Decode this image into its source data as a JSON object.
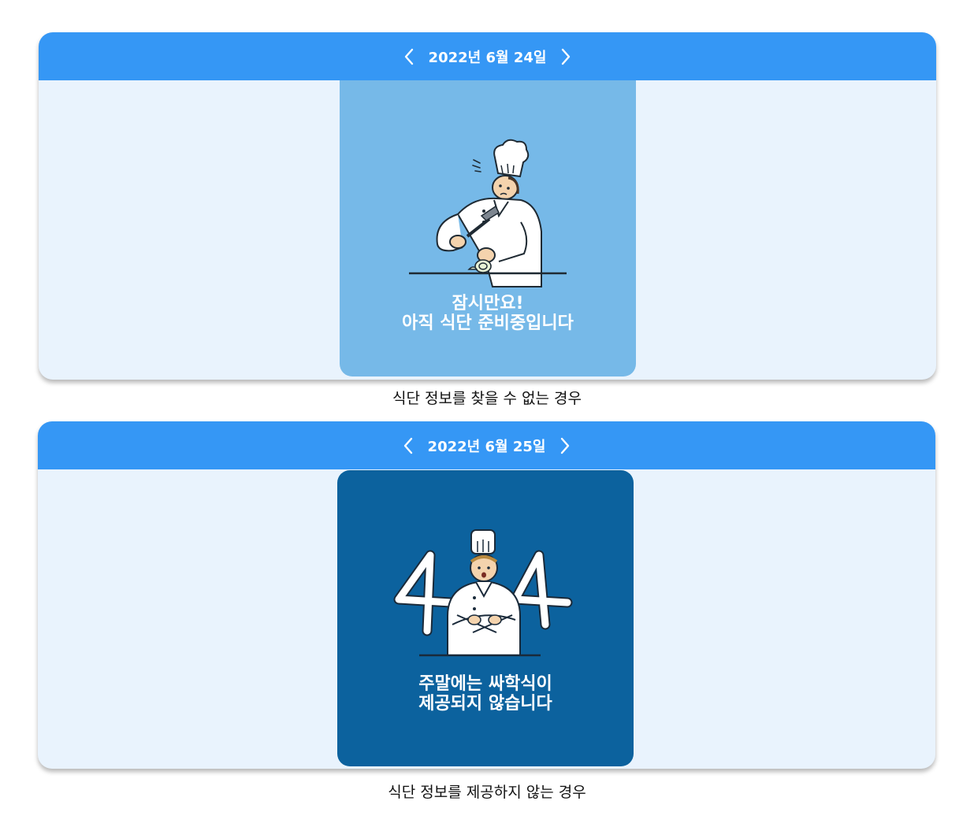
{
  "cards": [
    {
      "date": "2022년 6월 24일",
      "message": [
        "잠시만요!",
        "아직 식단 준비중입니다"
      ],
      "caption": "식단 정보를 찾을 수 없는 경우",
      "illustration_bg": "#76b9e8"
    },
    {
      "date": "2022년 6월 25일",
      "message": [
        "주말에는 싸학식이",
        "제공되지 않습니다"
      ],
      "caption": "식단 정보를 제공하지 않는 경우",
      "illustration_bg": "#0c629e"
    }
  ],
  "colors": {
    "header": "#3597f5",
    "card_bg": "#e9f3fd"
  },
  "icons": {
    "prev": "chevron-left-icon",
    "next": "chevron-right-icon",
    "chef_illustration": "chef-cutting-icon",
    "chef_404_illustration": "chef-404-icon"
  }
}
